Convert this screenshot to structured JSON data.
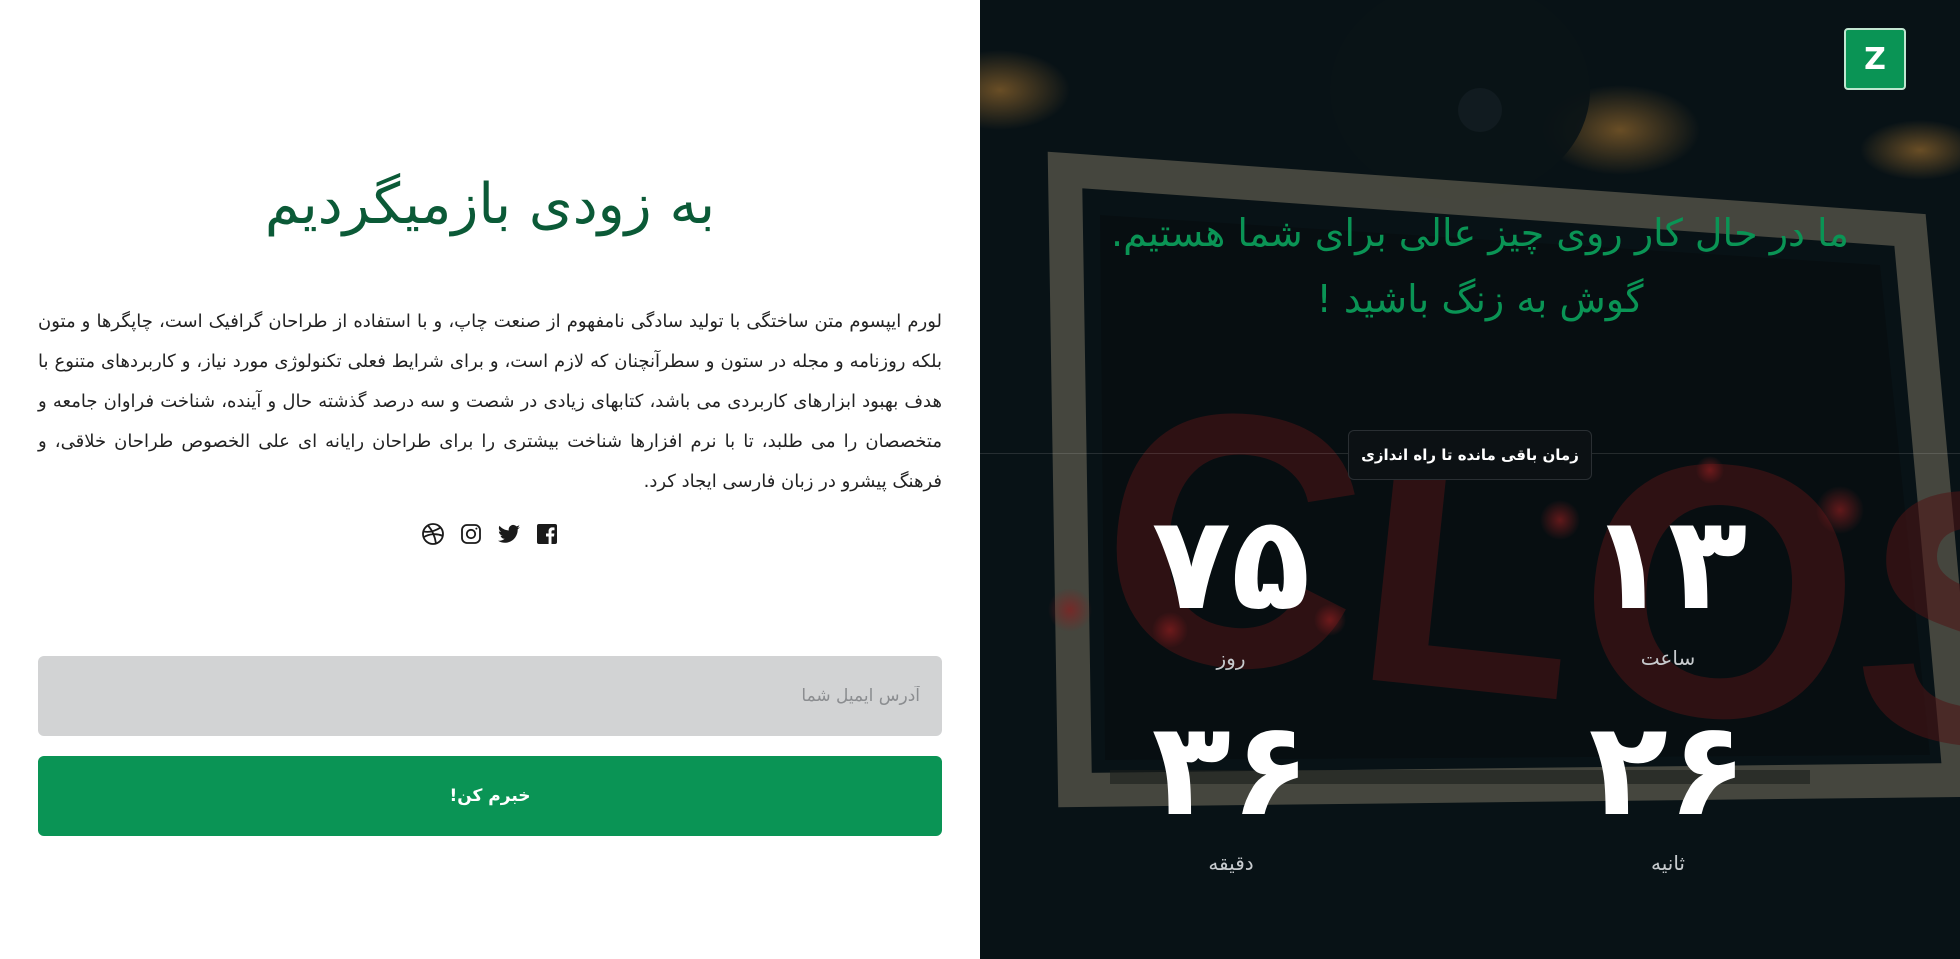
{
  "left": {
    "title": "به زودی بازمیگردیم",
    "description": "لورم ایپسوم متن ساختگی با تولید سادگی نامفهوم از صنعت چاپ، و با استفاده از طراحان گرافیک است، چاپگرها و متون بلکه روزنامه و مجله در ستون و سطرآنچنان که لازم است، و برای شرایط فعلی تکنولوژی مورد نیاز، و کاربردهای متنوع با هدف بهبود ابزارهای کاربردی می باشد، کتابهای زیادی در شصت و سه درصد گذشته حال و آینده، شناخت فراوان جامعه و متخصصان را می طلبد، تا با نرم افزارها شناخت بیشتری را برای طراحان رایانه ای علی الخصوص طراحان خلاقی، و فرهنگ پیشرو در زبان فارسی ایجاد کرد.",
    "social_icons": [
      "dribbble-icon",
      "instagram-icon",
      "twitter-icon",
      "facebook-icon"
    ],
    "email_placeholder": "آدرس ایمیل شما",
    "notify_label": "خبرم کن!"
  },
  "right": {
    "logo_text": "Z",
    "headline_line1": "ما در حال کار روی چیز عالی برای شما هستیم.",
    "headline_line2": "گوش به زنگ باشید !",
    "remaining_label": "زمان باقی مانده تا راه اندازی",
    "countdown": {
      "hours_value": "۱۳",
      "hours_label": "ساعت",
      "days_value": "۷۵",
      "days_label": "روز",
      "seconds_value": "۲۶",
      "seconds_label": "ثانیه",
      "minutes_value": "۳۶",
      "minutes_label": "دقیقه"
    }
  },
  "colors": {
    "brand_green": "#0a9455",
    "title_green": "#0b5a37",
    "input_bg": "#d2d3d4"
  }
}
